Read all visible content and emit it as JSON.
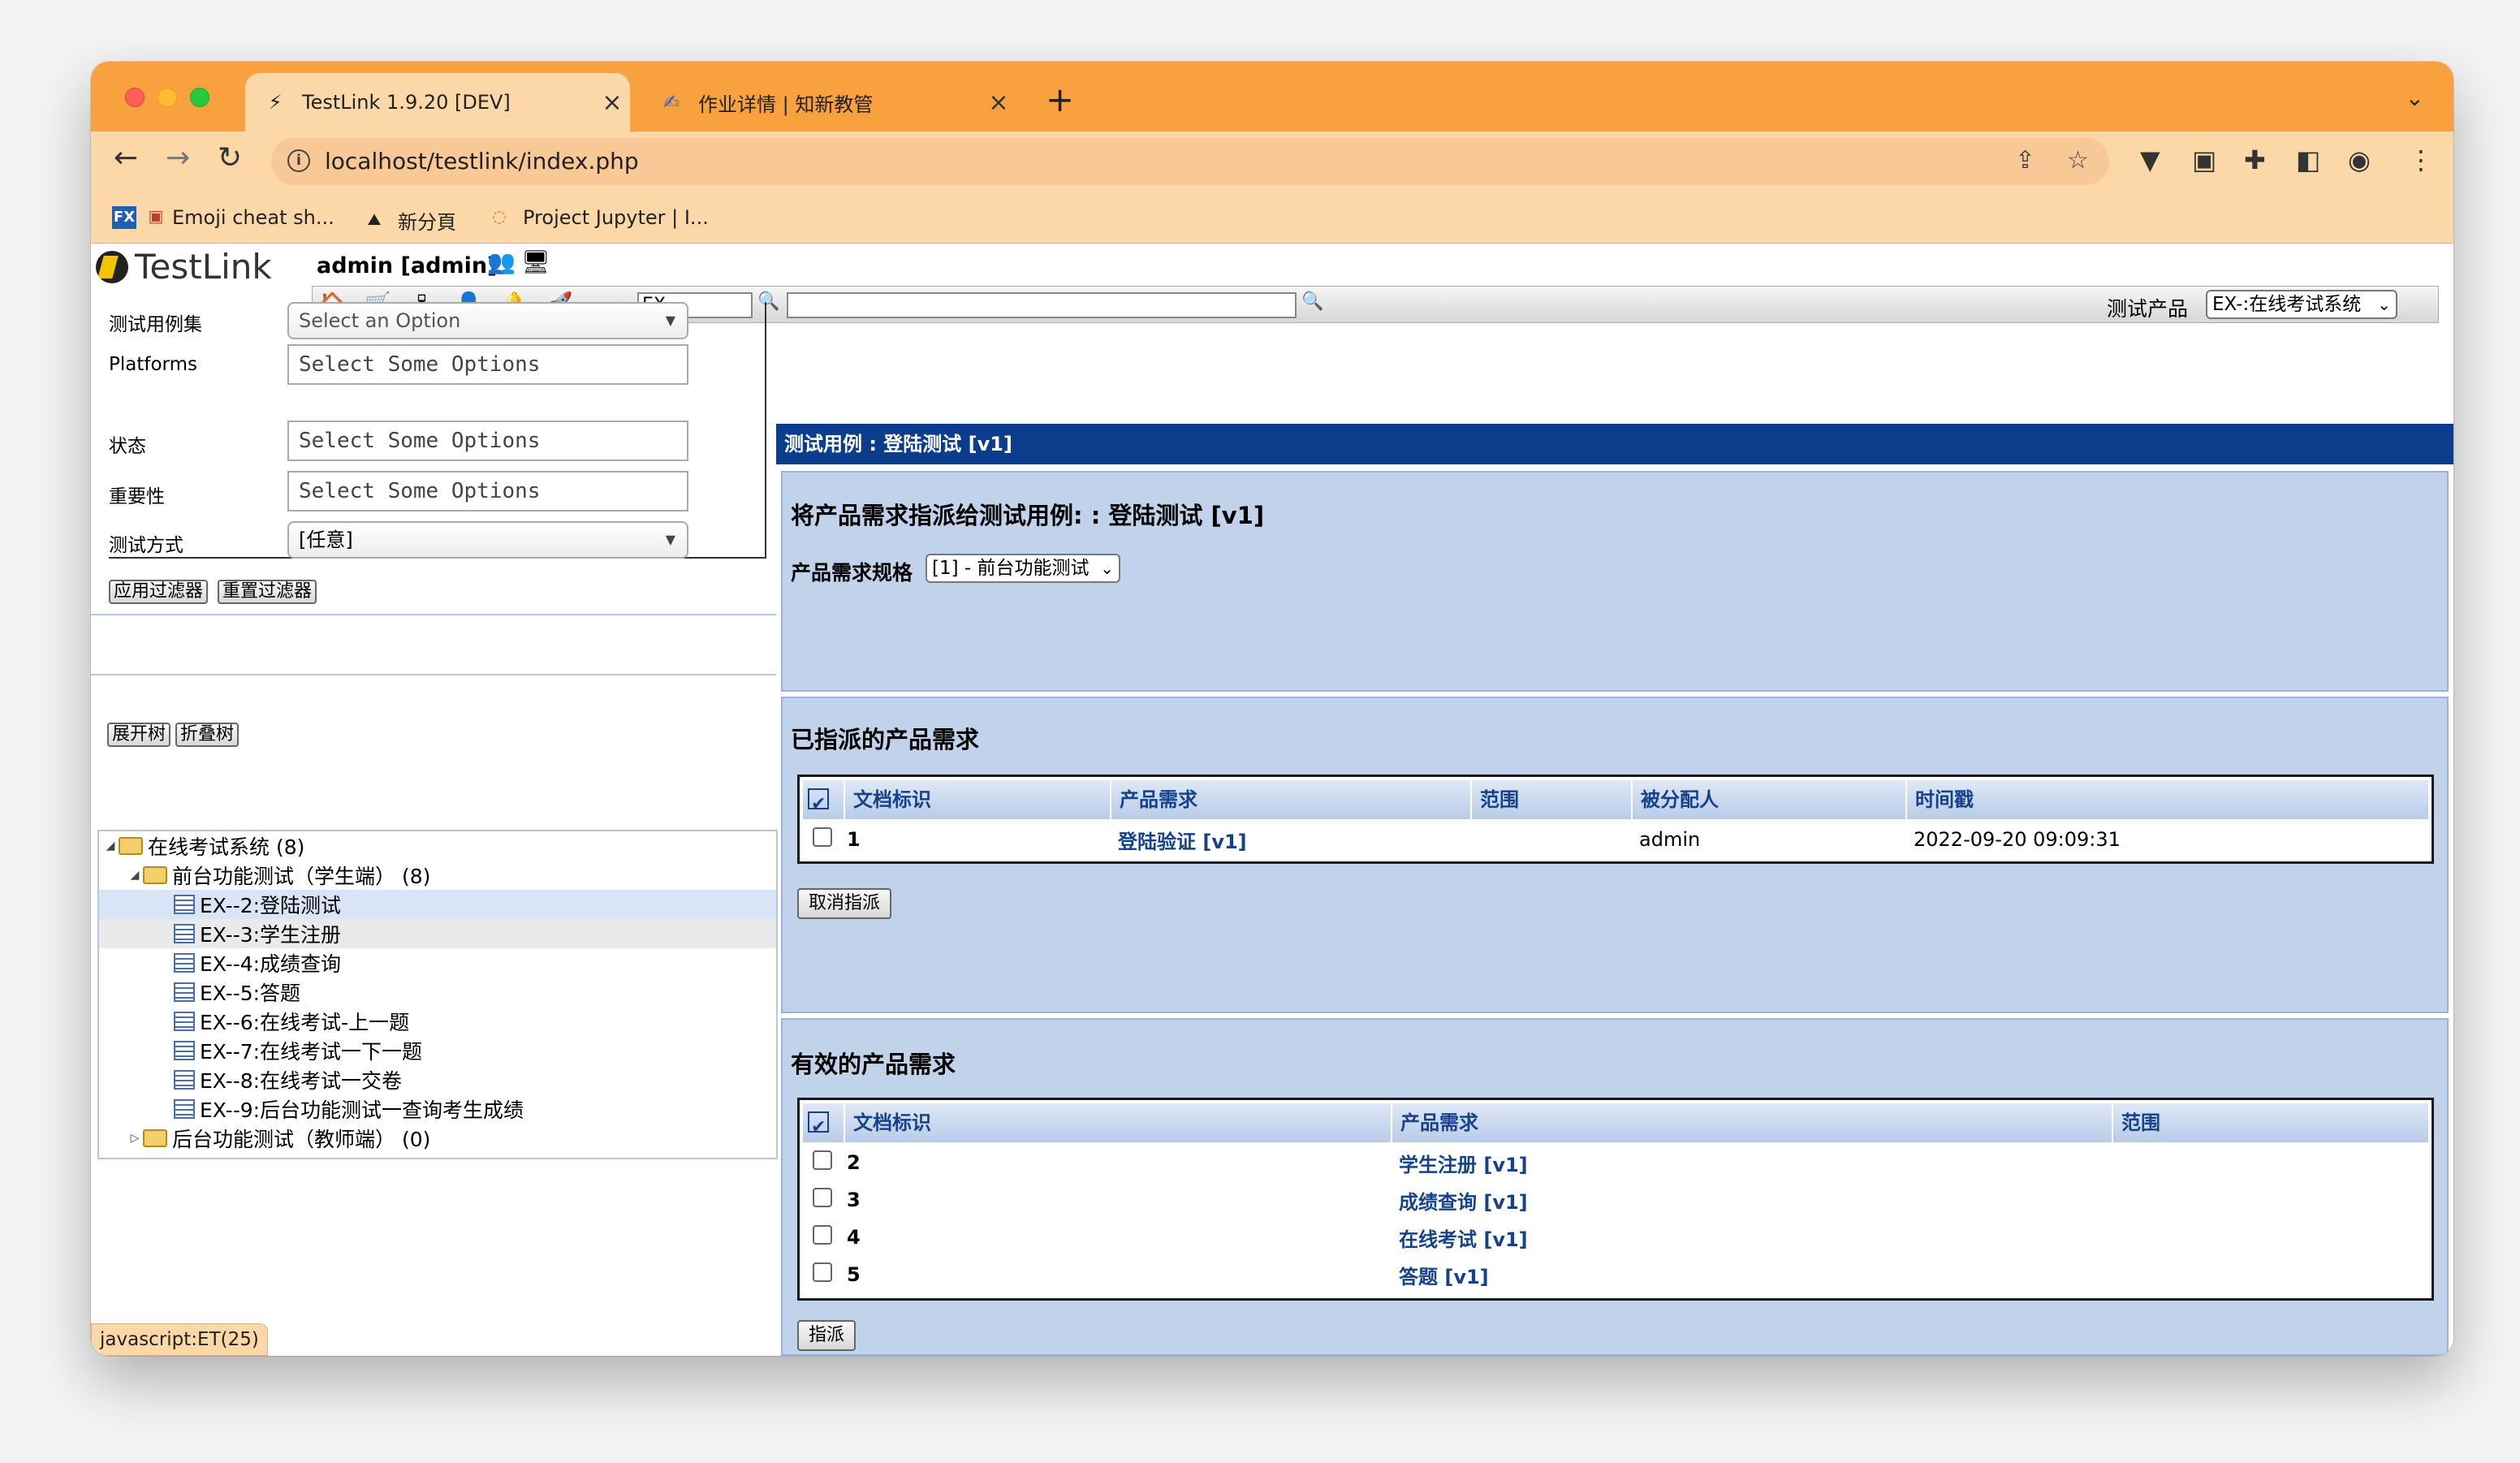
{
  "browser": {
    "tabs": [
      {
        "title": "TestLink 1.9.20 [DEV]",
        "active": true
      },
      {
        "title": "作业详情 | 知新教管",
        "active": false
      }
    ],
    "url": "localhost/testlink/index.php",
    "bookmarks": [
      "Emoji cheat sh...",
      "新分頁",
      "Project Jupyter | I..."
    ],
    "status_text": "javascript:ET(25)"
  },
  "header": {
    "logo": "TestLink",
    "user": "admin [admin]",
    "tc_search_value": "EX--",
    "product_label": "测试产品",
    "product_value": "EX-:在线考试系统"
  },
  "filters": {
    "rows": [
      {
        "label": "测试用例集",
        "value": "Select an Option"
      },
      {
        "label": "Platforms",
        "value": "Select Some Options"
      },
      {
        "label": "状态",
        "value": "Select Some Options"
      },
      {
        "label": "重要性",
        "value": "Select Some Options"
      },
      {
        "label": "测试方式",
        "value": "[任意]"
      }
    ],
    "apply_label": "应用过滤器",
    "reset_label": "重置过滤器",
    "expand_label": "展开树",
    "collapse_label": "折叠树"
  },
  "tree": [
    {
      "text": "在线考试系统 (8)"
    },
    {
      "text": "前台功能测试（学生端） (8)"
    },
    {
      "text": "EX--2:登陆测试"
    },
    {
      "text": "EX--3:学生注册"
    },
    {
      "text": "EX--4:成绩查询"
    },
    {
      "text": "EX--5:答题"
    },
    {
      "text": "EX--6:在线考试-上一题"
    },
    {
      "text": "EX--7:在线考试一下一题"
    },
    {
      "text": "EX--8:在线考试一交卷"
    },
    {
      "text": "EX--9:后台功能测试一查询考生成绩"
    },
    {
      "text": "后台功能测试（教师端） (0)"
    }
  ],
  "main": {
    "header": "测试用例 : 登陆测试 [v1]",
    "assign_title": "将产品需求指派给测试用例: : 登陆测试 [v1]",
    "spec_label": "产品需求规格",
    "spec_value": "[1] - 前台功能测试",
    "assigned": {
      "title": "已指派的产品需求",
      "columns": [
        "文档标识",
        "产品需求",
        "范围",
        "被分配人",
        "时间戳"
      ],
      "rows": [
        {
          "docid": "1",
          "req": "登陆验证 [v1]",
          "scope": "",
          "assignee": "admin",
          "timestamp": "2022-09-20 09:09:31"
        }
      ],
      "button": "取消指派"
    },
    "available": {
      "title": "有效的产品需求",
      "columns": [
        "文档标识",
        "产品需求",
        "范围"
      ],
      "rows": [
        {
          "docid": "2",
          "req": "学生注册 [v1]"
        },
        {
          "docid": "3",
          "req": "成绩查询 [v1]"
        },
        {
          "docid": "4",
          "req": "在线考试 [v1]"
        },
        {
          "docid": "5",
          "req": "答题 [v1]"
        }
      ],
      "button": "指派"
    }
  }
}
